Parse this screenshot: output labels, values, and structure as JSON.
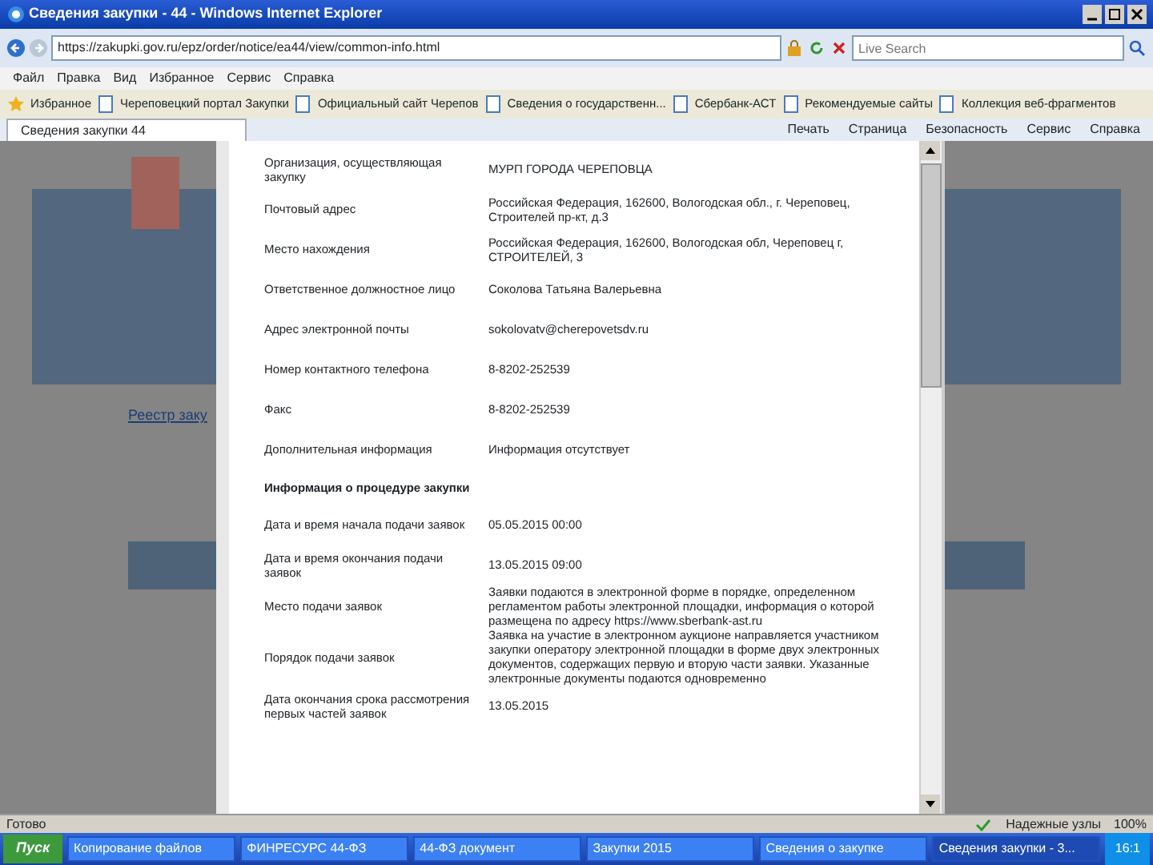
{
  "window": {
    "title": "Сведения закупки - 44 - Windows Internet Explorer"
  },
  "address_bar": {
    "url": "https://zakupki.gov.ru/epz/order/notice/ea44/view/common-info.html"
  },
  "search": {
    "placeholder": "Live Search"
  },
  "menu": [
    "Файл",
    "Правка",
    "Вид",
    "Избранное",
    "Сервис",
    "Справка"
  ],
  "favorites": [
    "Избранное",
    "Череповецкий портал Закупки",
    "Официальный сайт Черепов",
    "Сведения о государственн...",
    "Сбербанк-АСТ",
    "Рекомендуемые сайты",
    "Коллекция веб-фрагментов"
  ],
  "tab": {
    "label": "Сведения закупки 44"
  },
  "commands": [
    "Печать",
    "Страница",
    "Безопасность",
    "Сервис",
    "Справка"
  ],
  "page": {
    "link": "Реестр заку"
  },
  "dialog": {
    "rows": [
      {
        "kind": "field",
        "label": "Организация, осуществляющая закупку",
        "value": "МУРП ГОРОДА ЧЕРЕПОВЦА"
      },
      {
        "kind": "field",
        "label": "Почтовый адрес",
        "value": "Российская Федерация, 162600, Вологодская обл., г. Череповец, Строителей пр-кт, д.3"
      },
      {
        "kind": "field",
        "label": "Место нахождения",
        "value": "Российская Федерация, 162600, Вологодская обл, Череповец г, СТРОИТЕЛЕЙ, 3"
      },
      {
        "kind": "field",
        "label": "Ответственное должностное лицо",
        "value": "Соколова Татьяна Валерьевна"
      },
      {
        "kind": "field",
        "label": "Адрес электронной почты",
        "value": "sokolovatv@cherepovetsdv.ru"
      },
      {
        "kind": "field",
        "label": "Номер контактного телефона",
        "value": "8-8202-252539"
      },
      {
        "kind": "field",
        "label": "Факс",
        "value": "8-8202-252539"
      },
      {
        "kind": "field",
        "label": "Дополнительная информация",
        "value": "Информация отсутствует"
      },
      {
        "kind": "heading",
        "label": "Информация о процедуре закупки"
      },
      {
        "kind": "field",
        "label": "Дата и время начала подачи заявок",
        "value": "05.05.2015 00:00"
      },
      {
        "kind": "field",
        "label": "Дата и время окончания подачи заявок",
        "value": "13.05.2015 09:00"
      },
      {
        "kind": "field",
        "label": "Место подачи заявок",
        "value": "Заявки подаются в электронной форме в порядке, определенном регламентом работы электронной площадки, информация о которой размещена по адресу https://www.sberbank-ast.ru"
      },
      {
        "kind": "field",
        "label": "Порядок подачи заявок",
        "value": "Заявка на участие в электронном аукционе направляется участником закупки оператору электронной площадки в форме двух электронных документов, содержащих первую и вторую части заявки. Указанные электронные документы подаются одновременно"
      },
      {
        "kind": "field",
        "label": "Дата окончания срока рассмотрения первых частей заявок",
        "value": "13.05.2015"
      }
    ]
  },
  "status_bar": {
    "text": "Готово",
    "zone": "Надежные узлы",
    "zoom": "100%"
  },
  "taskbar": {
    "start": "Пуск",
    "windows": [
      {
        "label": "Копирование файлов",
        "selected": false
      },
      {
        "label": "ФИНРЕСУРС 44-ФЗ",
        "selected": false
      },
      {
        "label": "44-ФЗ документ",
        "selected": false
      },
      {
        "label": "Закупки 2015",
        "selected": false
      },
      {
        "label": "Сведения о закупке",
        "selected": false
      },
      {
        "label": "Сведения закупки - 3...",
        "selected": true
      }
    ],
    "clock": "16:1"
  }
}
